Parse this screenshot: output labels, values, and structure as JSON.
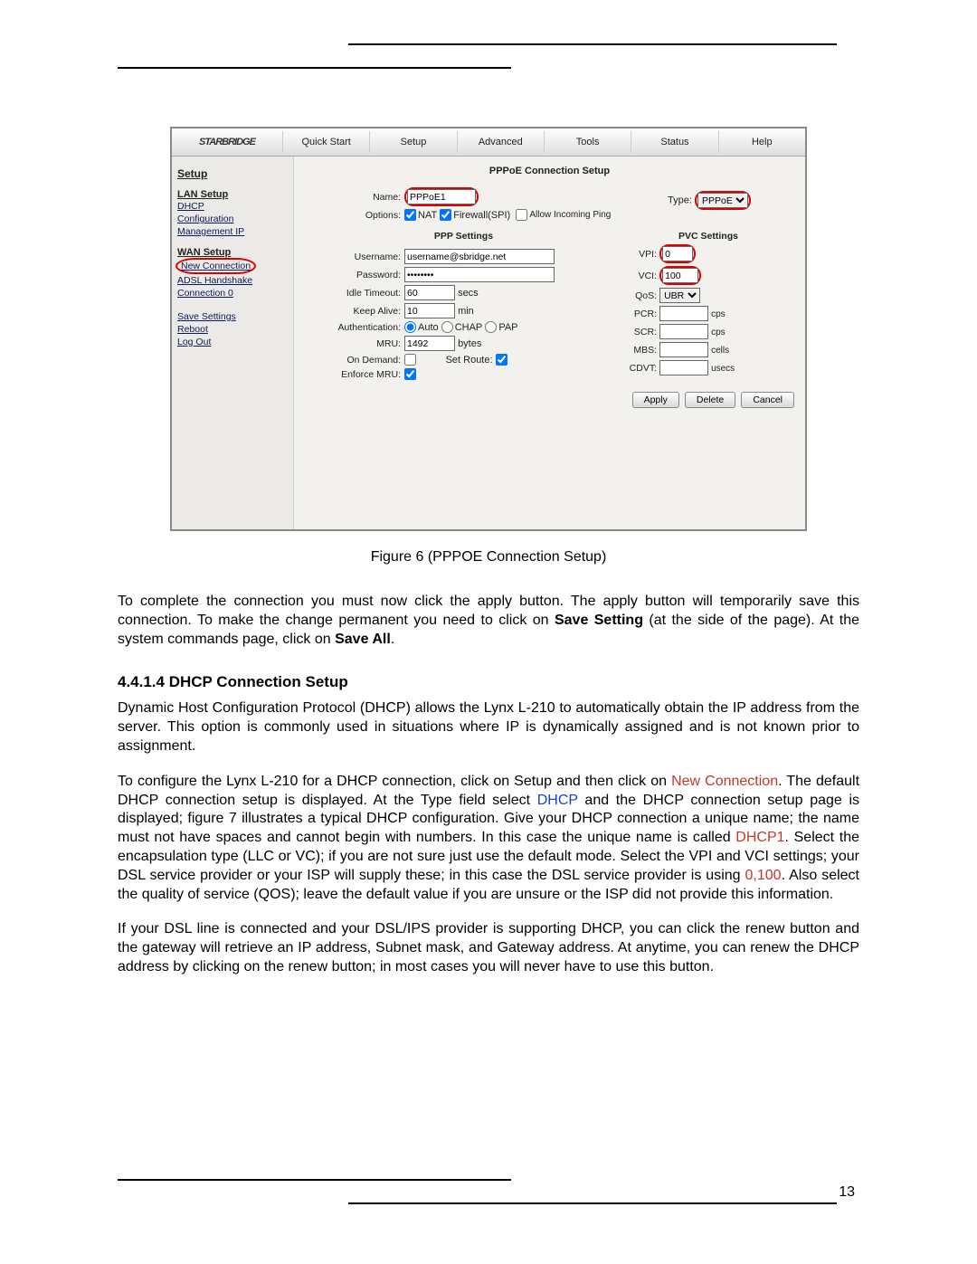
{
  "pageNumber": "13",
  "router": {
    "logo": "STARBRIDGE",
    "tabs": [
      "Quick Start",
      "Setup",
      "Advanced",
      "Tools",
      "Status",
      "Help"
    ],
    "sidebar": {
      "heading": "Setup",
      "lanSetup": "LAN Setup",
      "lanItems": [
        "DHCP",
        "Configuration",
        "Management IP"
      ],
      "wanSetup": "WAN Setup",
      "wanItems": {
        "newConnection": "New Connection",
        "adsl": "ADSL Handshake",
        "conn0": "Connection 0"
      },
      "bottom": [
        "Save Settings",
        "Reboot",
        "Log Out"
      ]
    },
    "panel": {
      "title": "PPPoE Connection Setup",
      "nameLabel": "Name:",
      "nameValue": "PPPoE1",
      "typeLabel": "Type:",
      "typeValue": "PPPoE",
      "optionsLabel": "Options:",
      "natLabel": "NAT",
      "firewallLabel": "Firewall(SPI)",
      "allowPing": "Allow Incoming Ping",
      "pppTitle": "PPP Settings",
      "usernameLabel": "Username:",
      "usernameValue": "username@sbridge.net",
      "passwordLabel": "Password:",
      "passwordValue": "••••••••",
      "idleLabel": "Idle Timeout:",
      "idleValue": "60",
      "idleUnit": "secs",
      "keepLabel": "Keep Alive:",
      "keepValue": "10",
      "keepUnit": "min",
      "authLabel": "Authentication:",
      "authAuto": "Auto",
      "authChap": "CHAP",
      "authPap": "PAP",
      "mruLabel": "MRU:",
      "mruValue": "1492",
      "mruUnit": "bytes",
      "onDemandLabel": "On Demand:",
      "setRouteLabel": "Set Route:",
      "enforceLabel": "Enforce MRU:",
      "pvcTitle": "PVC Settings",
      "vpiLabel": "VPI:",
      "vpiValue": "0",
      "vciLabel": "VCI:",
      "vciValue": "100",
      "qosLabel": "QoS:",
      "qosValue": "UBR",
      "pcrLabel": "PCR:",
      "pcrUnit": "cps",
      "scrLabel": "SCR:",
      "scrUnit": "cps",
      "mbsLabel": "MBS:",
      "mbsUnit": "cells",
      "cdvtLabel": "CDVT:",
      "cdvtUnit": "usecs",
      "apply": "Apply",
      "delete": "Delete",
      "cancel": "Cancel"
    }
  },
  "caption": "Figure 6 (PPPOE Connection Setup)",
  "text": {
    "para1a": "To complete the connection you must now click the apply button.  The apply button will temporarily save this connection. To make the change permanent you need to click on ",
    "para1b": "Save Setting",
    "para1c": " (at the side of the page).  At the system commands page, click on ",
    "para1d": "Save All",
    "para1e": ".",
    "heading": "4.4.1.4 DHCP Connection Setup",
    "para2": "Dynamic Host Configuration Protocol (DHCP) allows the Lynx L-210 to automatically obtain the IP address from the server. This option is commonly used in situations where IP is dynamically assigned and is not known prior to assignment.",
    "p3a": "To configure the Lynx L-210 for a DHCP connection, click on Setup and then click on ",
    "p3b": "New Connection",
    "p3c": ".  The default DHCP connection setup is displayed.  At the Type field select ",
    "p3d": "DHCP",
    "p3e": " and the DHCP connection setup page is displayed; figure 7 illustrates a typical DHCP configuration. Give your DHCP connection a unique name; the name must not have spaces and cannot begin with numbers.  In this case the unique name is called ",
    "p3f": "DHCP1",
    "p3g": ".  Select the encapsulation type (LLC or VC); if you are not sure just use the default mode.  Select the VPI and VCI settings; your DSL service provider or your ISP will supply these; in this case the DSL service provider is using ",
    "p3h": "0,100",
    "p3i": ". Also select the quality of service (QOS); leave the default value if you are unsure or the ISP did not provide this information.",
    "para4": "If your DSL line is connected and your DSL/IPS provider is supporting DHCP, you can click the renew button and the gateway will retrieve an IP address, Subnet mask, and Gateway address.  At anytime, you can renew the DHCP address by clicking on the renew button; in most cases you will never have to use this button."
  }
}
